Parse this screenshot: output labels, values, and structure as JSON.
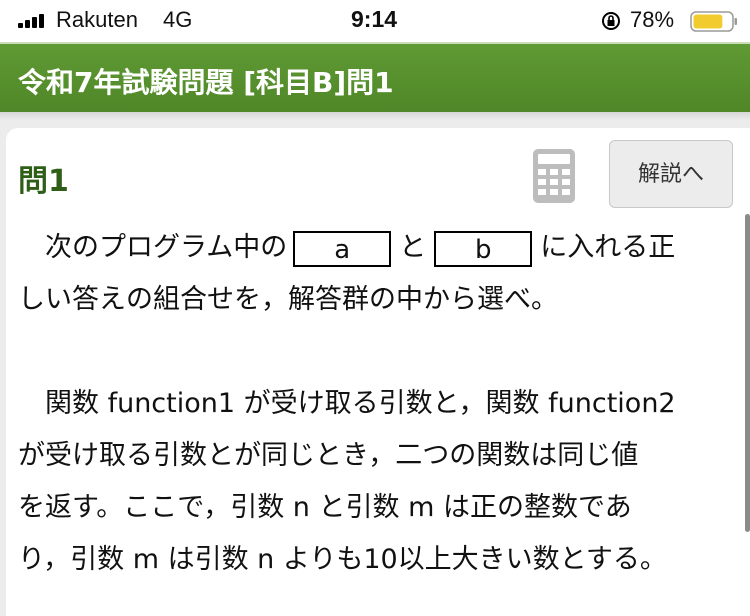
{
  "status_bar": {
    "carrier": "Rakuten",
    "network": "4G",
    "time": "9:14",
    "battery_percent": "78%",
    "battery_level": 0.78,
    "icons": [
      "signal-bars-icon",
      "orientation-lock-icon",
      "battery-icon"
    ]
  },
  "header": {
    "title": "令和7年試験問題 [科目B]問1"
  },
  "question": {
    "title": "問1",
    "explain_button": "解説へ",
    "calculator_icon": "calculator-icon",
    "para1_line1_pre": "　次のプログラム中の",
    "blank_a": "a",
    "para1_line1_mid": "と",
    "blank_b": "b",
    "para1_line1_post": "に入れる正",
    "para1_line2": "しい答えの組合せを，解答群の中から選べ。",
    "para2_line1": "　関数 function1 が受け取る引数と，関数 function2",
    "para2_line2": "が受け取る引数とが同じとき，二つの関数は同じ値",
    "para2_line3": "を返す。ここで，引数 n と引数 m は正の整数であ",
    "para2_line4": "り，引数 m は引数 n よりも10以上大きい数とする。"
  },
  "colors": {
    "header_green": "#5a962f",
    "title_green": "#2e5e17",
    "battery_yellow": "#f2cc2e"
  }
}
